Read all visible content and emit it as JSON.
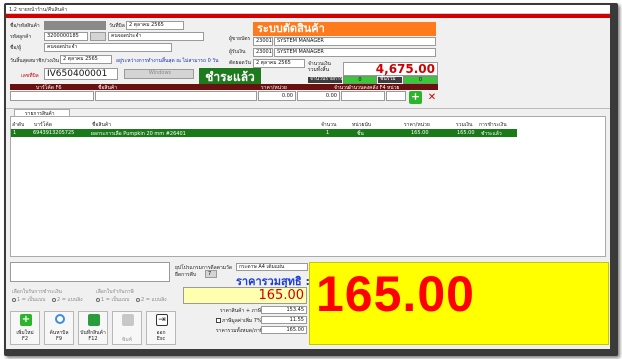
{
  "window": {
    "title": "1.2 ขายหน้าร้าน/คืนสินค้า"
  },
  "header": {
    "barcode_label": "ชื่อ/รหัสสินค้า",
    "invoice_date_label": "วันที่บิล",
    "invoice_date_value": "2  ตุลาคม  2565",
    "member_no_label": "รหัสลูกค้า",
    "member_no_value": "3200000185",
    "member_name_value": "คนจอดประจำ",
    "name_label": "ชื่อ/ผู้",
    "name_value": "คนจอดประจำ",
    "expire_label": "วันสิ้นสุดสมาชิก/วงเงิน",
    "expire_value": "2  ตุลาคม  2565",
    "expire_note": "อยู่ระหว่างการทำงานสิ้นสุด ณ ไม่สามารถ 0 วัน",
    "doc_no_label": "เลขที่บิล",
    "doc_no_value": "IV650400001",
    "doc_button": "Windows",
    "status": "ชำระแล้ว",
    "banner": "ระบบตัดสินค้า",
    "cashier_label": "ผู้ขายบัตร",
    "cashier_code": "23001",
    "cashier_name": "SYSTEM MANAGER",
    "approver_label": "ผู้รับเงิน",
    "approver_code": "23001",
    "approver_name": "SYSTEM MANAGER",
    "due_label": "ตัดยอดวัน",
    "due_value": "2  ตุลาคม  2565",
    "total_label": "จำนวนเงิน รวมทั้งสิ้น",
    "total_value": "4,675.00",
    "qty_label": "จำนวนรายการ",
    "qty_value": "0",
    "pcs_label": "ชิ้นรวม",
    "pcs_value": "0"
  },
  "entry": {
    "cols": [
      "บาร์โค้ด F6",
      "ชื่อสินค้า",
      "ราคา/หน่วย",
      "จำนวน",
      "จำนวนคงคลัง F4",
      "หน่วย"
    ],
    "price_value": "0.00",
    "qty_value": "0.00"
  },
  "tab": "รายการสินค้า",
  "grid": {
    "headers": [
      "ลำดับ",
      "บาร์โค้ด",
      "ชื่อสินค้า",
      "จำนวน",
      "หน่วยนับ",
      "ราคา/หน่วย",
      "รวมเงิน",
      "การชำระเงิน"
    ],
    "rows": [
      {
        "no": "1",
        "barcode": "6943913205725",
        "name": "ผลกระการเลือ Pumpkin 20 mm #26401",
        "qty": "1",
        "unit": "ชิ้น",
        "price": "165.00",
        "total": "165.00",
        "status": "ชำระแล้ว"
      }
    ]
  },
  "footer": {
    "promo_label": "ยุปโปรแกรมการดีลตามวัด",
    "promo_sub": "ยืดการตีบ",
    "promo_value": "7",
    "paper_value": "กระดาษ A4 เต็มแผ่น",
    "net_label": "ราคารวมสุทธิ :",
    "net_value": "165.00",
    "big_display": "165.00",
    "print_label": "เลือกใบรับการชำระเงิน",
    "print_opt1": "1 = เป็นแบบ",
    "print_opt2": "2 = แบบลิง",
    "tax_label": "เลือกใบกำกับภาษี",
    "tax_opt1": "1 = เป็นแบบ",
    "tax_opt2": "2 = แบบลิง",
    "sub_label": "ราคาสินค้า + ภาษี",
    "sub_value": "153.45",
    "vat_label": "ภาษีมูลค่าเพิ่ม 7%",
    "vat_value": "11.55",
    "grand_label": "ราคารวมทั้งหมด/ภาษี",
    "grand_value": "165.00"
  },
  "toolbar": [
    {
      "icon": "add-icon",
      "label": "เพิ่มใหม่",
      "key": "F2",
      "color": "#2bb52b"
    },
    {
      "icon": "search-icon",
      "label": "ค้นหาบิล",
      "key": "F9",
      "color": "#3c8ce0"
    },
    {
      "icon": "save-icon",
      "label": "บันทึกสินค้า",
      "key": "F12",
      "color": "#2a9d3a"
    },
    {
      "icon": "print-icon",
      "label": "พิมพ์",
      "key": "F10",
      "color": "#b0b0b0"
    },
    {
      "icon": "exit-icon",
      "label": "ออก",
      "key": "Esc",
      "color": "#333333"
    }
  ]
}
